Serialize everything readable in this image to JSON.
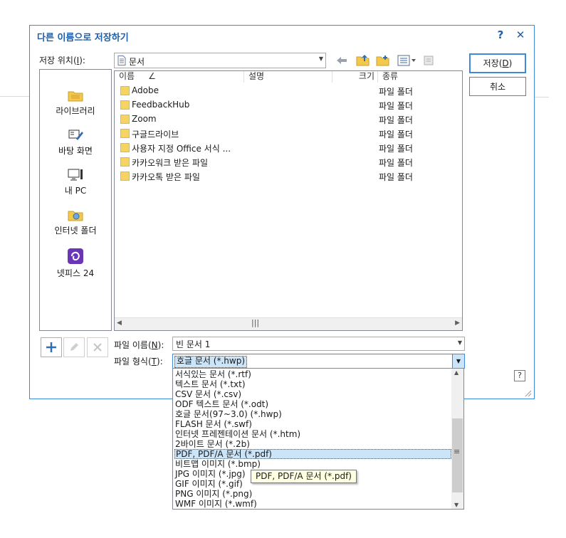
{
  "dialog": {
    "title": "다른 이름으로 저장하기",
    "help_glyph": "?",
    "close_glyph": "✕",
    "corner_help": "?"
  },
  "location": {
    "label": "저장 위치(",
    "label_key": "I",
    "label_suffix": "):",
    "value": "문서"
  },
  "buttons": {
    "save_prefix": "저장(",
    "save_key": "D",
    "save_suffix": ")",
    "cancel": "취소"
  },
  "places": [
    {
      "label": "라이브러리",
      "icon": "library-icon"
    },
    {
      "label": "바탕 화면",
      "icon": "desktop-icon"
    },
    {
      "label": "내 PC",
      "icon": "computer-icon"
    },
    {
      "label": "인터넷 폴더",
      "icon": "internet-folder-icon"
    },
    {
      "label": "넷피스 24",
      "icon": "netffice-icon"
    }
  ],
  "columns": {
    "name": "이름",
    "sort_glyph": "∠",
    "desc": "설명",
    "size": "크기",
    "type": "종류"
  },
  "files": [
    {
      "name": "Adobe",
      "type": "파일 폴더"
    },
    {
      "name": "FeedbackHub",
      "type": "파일 폴더"
    },
    {
      "name": "Zoom",
      "type": "파일 폴더"
    },
    {
      "name": "구글드라이브",
      "type": "파일 폴더"
    },
    {
      "name": "사용자 지정 Office 서식 ...",
      "type": "파일 폴더"
    },
    {
      "name": "카카오워크 받은 파일",
      "type": "파일 폴더"
    },
    {
      "name": "카카오톡 받은 파일",
      "type": "파일 폴더"
    }
  ],
  "filename": {
    "label": "파일 이름(",
    "label_key": "N",
    "label_suffix": "):",
    "value": "빈 문서 1"
  },
  "filetype": {
    "label": "파일 형식(",
    "label_key": "T",
    "label_suffix": "):",
    "value": "호글 문서 (*.hwp)",
    "options": [
      "서식있는 문서 (*.rtf)",
      "텍스트 문서 (*.txt)",
      "CSV 문서 (*.csv)",
      "ODF 텍스트 문서 (*.odt)",
      "호글 문서(97~3.0) (*.hwp)",
      "FLASH 문서 (*.swf)",
      "인터넷 프레젠테이션 문서 (*.htm)",
      "2바이트 문서 (*.2b)",
      "PDF, PDF/A 문서 (*.pdf)",
      "비트맵 이미지 (*.bmp)",
      "JPG 이미지 (*.jpg)",
      "GIF 이미지 (*.gif)",
      "PNG 이미지 (*.png)",
      "WMF 이미지 (*.wmf)"
    ],
    "selected_option": "PDF, PDF/A 문서 (*.pdf)"
  },
  "tooltip": "PDF, PDF/A 문서 (*.pdf)",
  "scroll": {
    "hthumb": "|||",
    "vthumb": "≡"
  },
  "colors": {
    "accent": "#1e5ea8",
    "border": "#3c8ad9",
    "selection": "#cce4f7",
    "tooltip_bg": "#ffffe1"
  }
}
